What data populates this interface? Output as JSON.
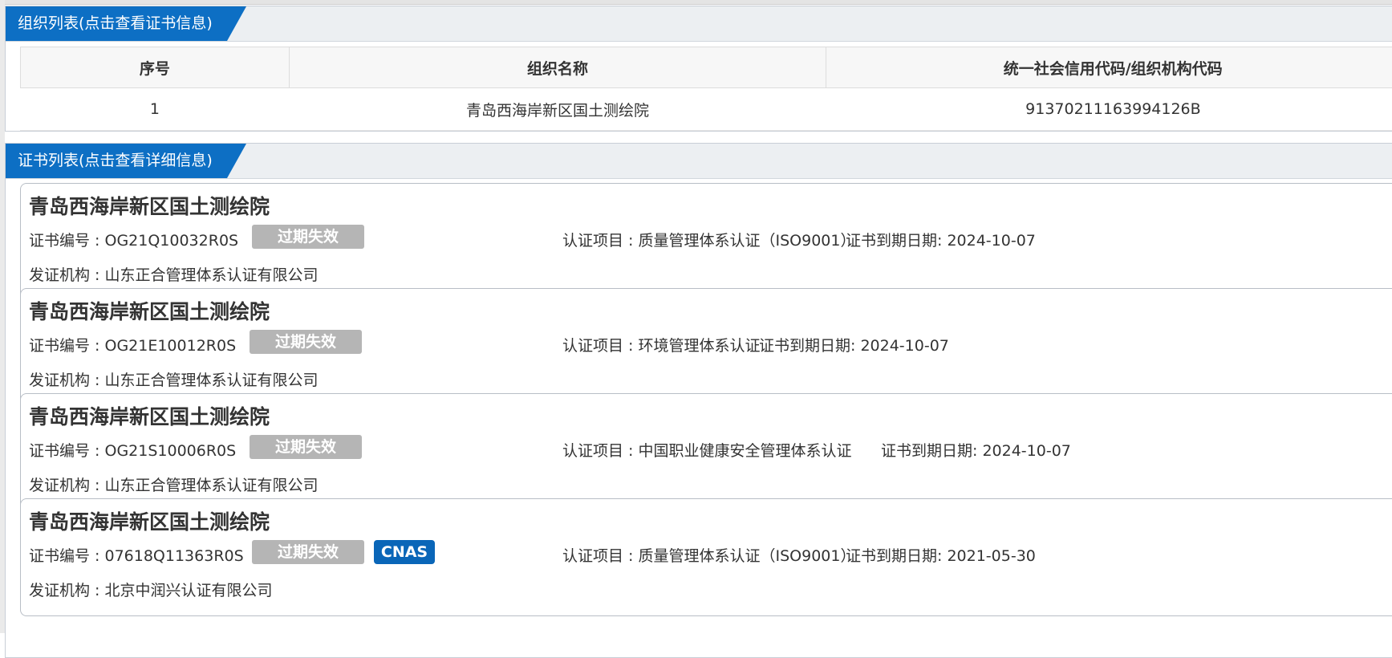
{
  "org_panel": {
    "title": "组织列表(点击查看证书信息)",
    "columns": [
      "序号",
      "组织名称",
      "统一社会信用代码/组织机构代码"
    ],
    "rows": [
      {
        "index": "1",
        "name": "青岛西海岸新区国土测绘院",
        "code": "91370211163994126B"
      }
    ]
  },
  "cert_panel": {
    "title": "证书列表(点击查看详细信息)",
    "labels": {
      "cert_no": "证书编号 : ",
      "project": "认证项目 : ",
      "expiry": "证书到期日期: ",
      "issuer": "发证机构 : "
    },
    "certificates": [
      {
        "org_name": "青岛西海岸新区国土测绘院",
        "cert_no": "OG21Q10032R0S",
        "status": "过期失效",
        "project": "质量管理体系认证（ISO9001）",
        "expiry": "2024-10-07",
        "issuer": "山东正合管理体系认证有限公司"
      },
      {
        "org_name": "青岛西海岸新区国土测绘院",
        "cert_no": "OG21E10012R0S",
        "status": "过期失效",
        "project": "环境管理体系认证",
        "expiry": "2024-10-07",
        "issuer": "山东正合管理体系认证有限公司"
      },
      {
        "org_name": "青岛西海岸新区国土测绘院",
        "cert_no": "OG21S10006R0S",
        "status": "过期失效",
        "project": "中国职业健康安全管理体系认证",
        "expiry": "2024-10-07",
        "issuer": "山东正合管理体系认证有限公司"
      },
      {
        "org_name": "青岛西海岸新区国土测绘院",
        "cert_no": "07618Q11363R0S",
        "status": "过期失效",
        "accreditation": "CNAS",
        "project": "质量管理体系认证（ISO9001）",
        "expiry": "2021-05-30",
        "issuer": "北京中润兴认证有限公司"
      }
    ]
  },
  "colors": {
    "header_tab": "#0d6fc4",
    "expired_badge": "#b5b5b5",
    "cnas_badge": "#0a66b8"
  }
}
